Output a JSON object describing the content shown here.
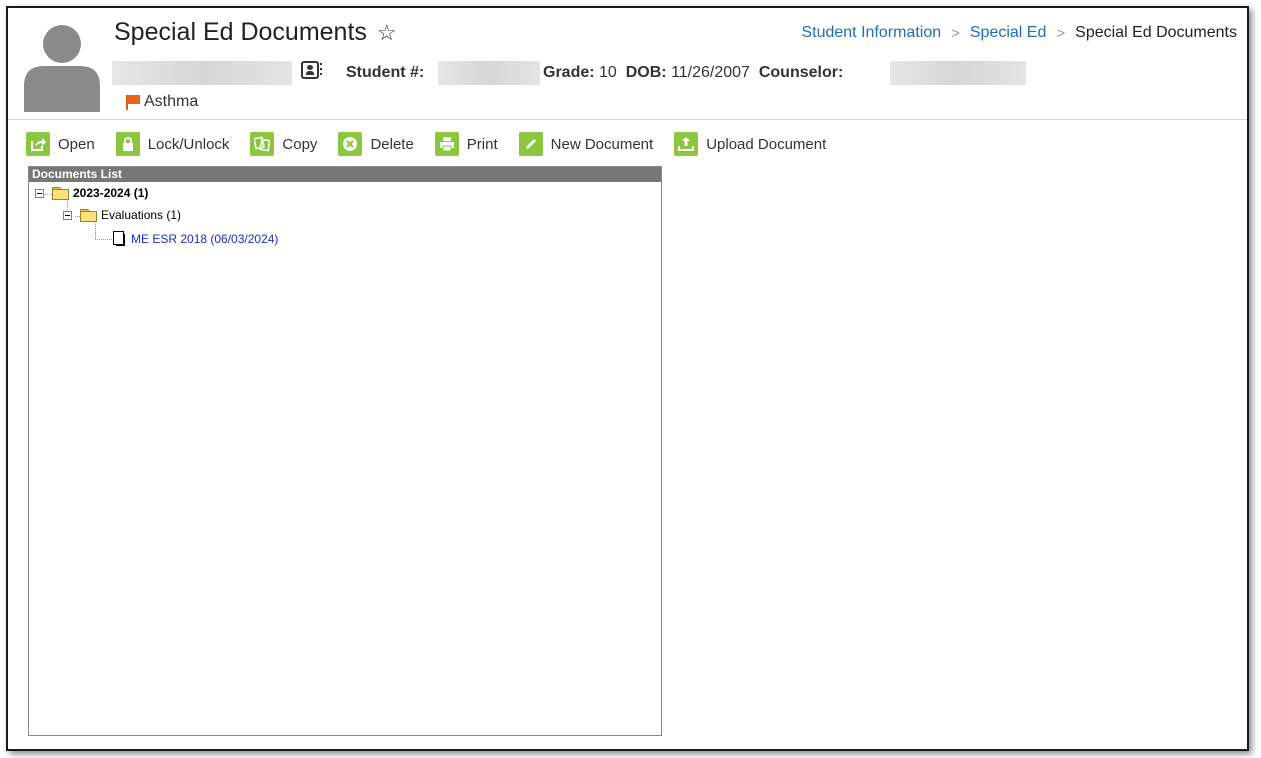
{
  "header": {
    "title": "Special Ed Documents",
    "breadcrumb": [
      {
        "label": "Student Information"
      },
      {
        "label": "Special Ed"
      },
      {
        "label": "Special Ed Documents"
      }
    ],
    "student_number_label": "Student #:",
    "grade_label": "Grade:",
    "grade_value": "10",
    "dob_label": "DOB:",
    "dob_value": "11/26/2007",
    "counselor_label": "Counselor:",
    "flag_label": "Asthma"
  },
  "toolbar": {
    "open": "Open",
    "lock": "Lock/Unlock",
    "copy": "Copy",
    "delete": "Delete",
    "print": "Print",
    "new_document": "New Document",
    "upload_document": "Upload Document"
  },
  "documents_list": {
    "heading": "Documents List",
    "year_folder": "2023-2024 (1)",
    "sub_folder": "Evaluations (1)",
    "document": "ME ESR 2018 (06/03/2024)"
  },
  "colors": {
    "accent_green": "#8cc63f",
    "link_blue": "#1f6fb8",
    "flag_orange": "#e8641c",
    "panel_header": "#777777"
  }
}
